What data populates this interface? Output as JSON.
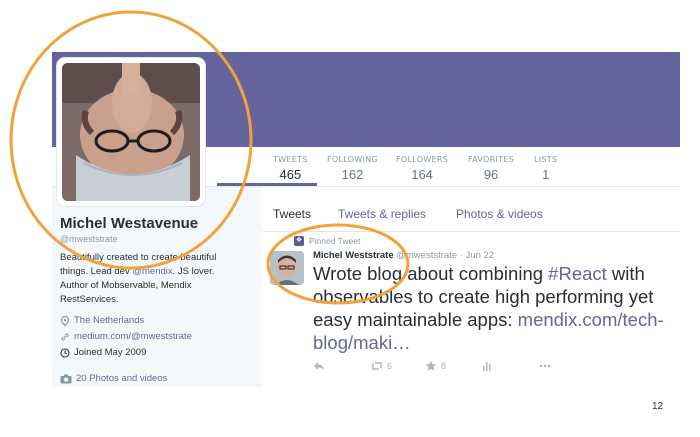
{
  "colors": {
    "banner": "#65639e",
    "accent": "#66659b",
    "annotation": "#f0a23c"
  },
  "profile": {
    "name": "Michel Westavenue",
    "handle": "@mweststrate",
    "bio_lines": [
      "Beautifully created to create beautiful",
      "things. Lead dev ",
      "@mendix",
      ". JS lover.",
      "Author of Mobservable, Mendix",
      "RestServices."
    ],
    "location": "The Netherlands",
    "location_icon": "map-pin-icon",
    "website": "medium.com/@mweststrate",
    "website_icon": "link-icon",
    "joined": "Joined May 2009",
    "joined_icon": "clock-icon",
    "photos": "20 Photos and videos",
    "photos_icon": "camera-icon"
  },
  "stats": [
    {
      "label": "TWEETS",
      "value": "465"
    },
    {
      "label": "FOLLOWING",
      "value": "162"
    },
    {
      "label": "FOLLOWERS",
      "value": "164"
    },
    {
      "label": "FAVORITES",
      "value": "96"
    },
    {
      "label": "LISTS",
      "value": "1"
    }
  ],
  "tabs": [
    {
      "label": "Tweets",
      "active": true
    },
    {
      "label": "Tweets & replies",
      "active": false
    },
    {
      "label": "Photos & videos",
      "active": false
    }
  ],
  "tweet": {
    "pinned_label": "Pinned Tweet",
    "author": "Michel Weststrate",
    "meta": "@mweststrate · Jun 22",
    "text_line1_pre": "Wrote blog about combining ",
    "text_hashtag": "#React",
    "text_line1_post": " with",
    "text_line2": "observables to create high performing yet",
    "text_line3_pre": "easy maintainable apps: ",
    "text_link1": "mendix.com/tech-",
    "text_link2": "blog/maki…",
    "retweets": "6",
    "favorites": "8"
  },
  "slide_number": "12"
}
